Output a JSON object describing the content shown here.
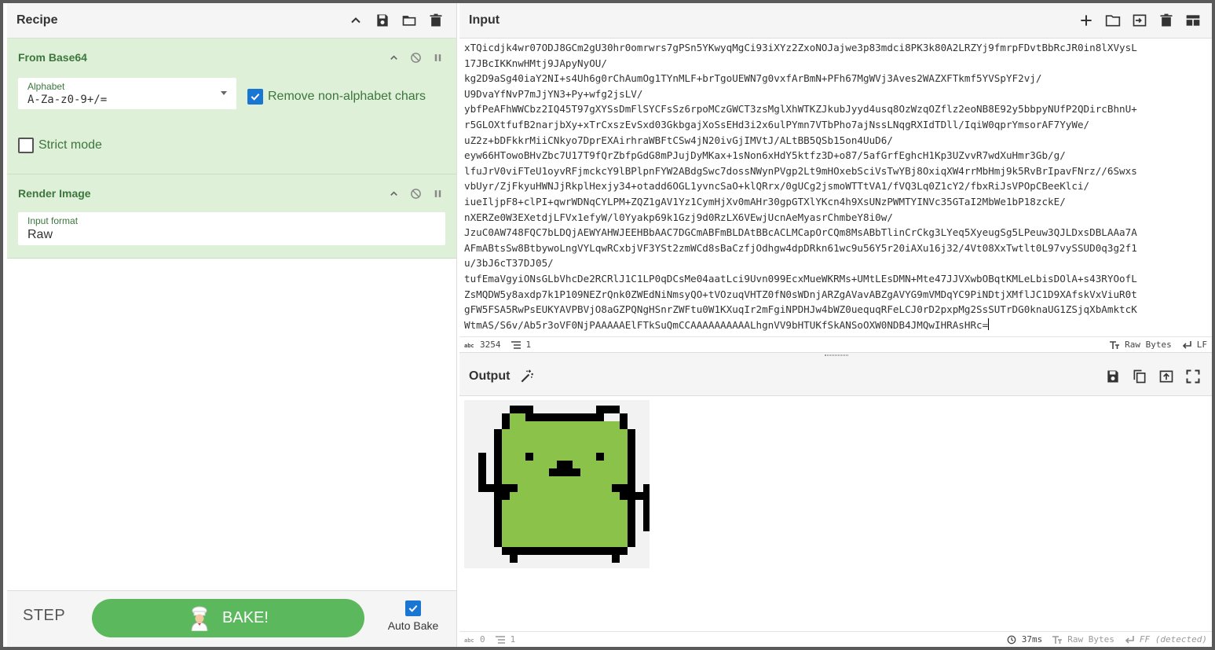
{
  "recipe": {
    "title": "Recipe",
    "operations": [
      {
        "name": "From Base64",
        "alphabet_label": "Alphabet",
        "alphabet_value": "A-Za-z0-9+/=",
        "remove_non_alphabet_label": "Remove non-alphabet chars",
        "remove_non_alphabet_checked": true,
        "strict_mode_label": "Strict mode",
        "strict_mode_checked": false
      },
      {
        "name": "Render Image",
        "input_format_label": "Input format",
        "input_format_value": "Raw"
      }
    ],
    "footer": {
      "step_label": "STEP",
      "bake_label": "BAKE!",
      "auto_bake_label": "Auto Bake",
      "auto_bake_checked": true
    }
  },
  "input": {
    "title": "Input",
    "lines": [
      "xTQicdjk4wr07ODJ8GCm2gU30hr0omrwrs7gPSn5YKwyqMgCi93iXYz2ZxoNOJajwe3p83mdci8PK3k80A2LRZYj9fmrpFDvtBbRcJR0in8lXVysL",
      "17JBcIKKnwHMtj9JApyNyOU/",
      "kg2D9aSg40iaY2NI+s4Uh6g0rChAumOg1TYnMLF+brTgoUEWN7g0vxfArBmN+PFh67MgWVj3Aves2WAZXFTkmf5YVSpYF2vj/",
      "U9DvaYfNvP7mJjYN3+Py+wfg2jsLV/",
      "ybfPeAFhWWCbz2IQ45T97gXYSsDmFlSYCFsSz6rpoMCzGWCT3zsMglXhWTKZJkubJyyd4usq8OzWzqOZflz2eoNB8E92y5bbpyNUfP2QDircBhnU+",
      "r5GLOXtfufB2narjbXy+xTrCxszEvSxd03GkbgajXoSsEHd3i2x6ulPYmn7VTbPho7ajNssLNqgRXIdTDll/IqiW0qprYmsorAF7YyWe/",
      "uZ2z+bDFkkrMiiCNkyo7DprEXAirhraWBFtCSw4jN20ivGjIMVtJ/ALtBB5QSb15on4UuD6/",
      "eyw66HTowoBHvZbc7U17T9fQrZbfpGdG8mPJujDyMKax+1sNon6xHdY5ktfz3D+o87/5afGrfEghcH1Kp3UZvvR7wdXuHmr3Gb/g/",
      "lfuJrV0viFTeU1oyvRFjmckcY9lBPlpnFYW2ABdgSwc7dossNWynPVgp2Lt9mHOxebSciVsTwYBj8OxiqXW4rrMbHmj9k5RvBrIpavFNrz//6Swxs",
      "vbUyr/ZjFkyuHWNJjRkplHexjy34+otadd6OGL1yvncSaO+klQRrx/0gUCg2jsmoWTTtVA1/fVQ3Lq0Z1cY2/fbxRiJsVPOpCBeeKlci/",
      "iueIljpF8+clPI+qwrWDNqCYLPM+ZQZ1gAV1Yz1CymHjXv0mAHr30gpGTXlYKcn4h9XsUNzPWMTYINVc35GTaI2MbWe1bP18zckE/",
      "nXERZe0W3EXetdjLFVx1efyW/l0Yyakp69k1Gzj9d0RzLX6VEwjUcnAeMyasrChmbeY8i0w/",
      "JzuC0AW748FQC7bLDQjAEWYAHWJEEHBbAAC7DGCmABFmBLDAtBBcACLMCapOrCQm8MsABbTlinCrCkg3LYeq5XyeugSg5LPeuw3QJLDxsDBLAAa7A",
      "AFmABtsSw8BtbywoLngVYLqwRCxbjVF3YSt2zmWCd8sBaCzfjOdhgw4dpDRkn61wc9u56Y5r20iAXu16j32/4Vt08XxTwtlt0L97vySSUD0q3g2f1",
      "u/3bJ6cT37DJ05/",
      "tufEmaVgyiONsGLbVhcDe2RCRlJ1C1LP0qDCsMe04aatLci9Uvn099EcxMueWKRMs+UMtLEsDMN+Mte47JJVXwbOBqtKMLeLbisDOlA+s43RYOofL",
      "ZsMQDW5y8axdp7k1P109NEZrQnk0ZWEdNiNmsyQO+tVOzuqVHTZ0fN0sWDnjARZgAVavABZgAVYG9mVMDqYC9PiNDtjXMflJC1D9XAfskVxViuR0t",
      "gFW5FSA5RwPsEUKYAVPBVjO8aGZPQNgHSnrZWFtu0W1KXuqIr2mFgiNPDHJw4bWZ0uequqRFeLCJ0rD2pxpMg2SsSUTrDG0knaUG1ZSjqXbAmktcK",
      "WtmAS/S6v/Ab5r3oVF0NjPAAAAAElFTkSuQmCCAAAAAAAAAALhgnVV9bHTUKfSkANSoOXW0NDB4JMQwIHRAsHRc="
    ],
    "status": {
      "char_count": "3254",
      "line_count": "1",
      "encoding": "Raw Bytes",
      "eol": "LF"
    }
  },
  "output": {
    "title": "Output",
    "image_icon": "cat-pixel-art",
    "image_colors": {
      "body": "#8bc34a",
      "outline": "#000000",
      "background": "#f2f2f2"
    },
    "status": {
      "char_count": "0",
      "line_count": "1",
      "time": "37ms",
      "encoding": "Raw Bytes",
      "eol": "FF (detected)"
    }
  },
  "colors": {
    "op_background": "#dff0d8",
    "op_text": "#3c763d",
    "bake_green": "#5cb85c",
    "checkbox_blue": "#1976d2"
  }
}
